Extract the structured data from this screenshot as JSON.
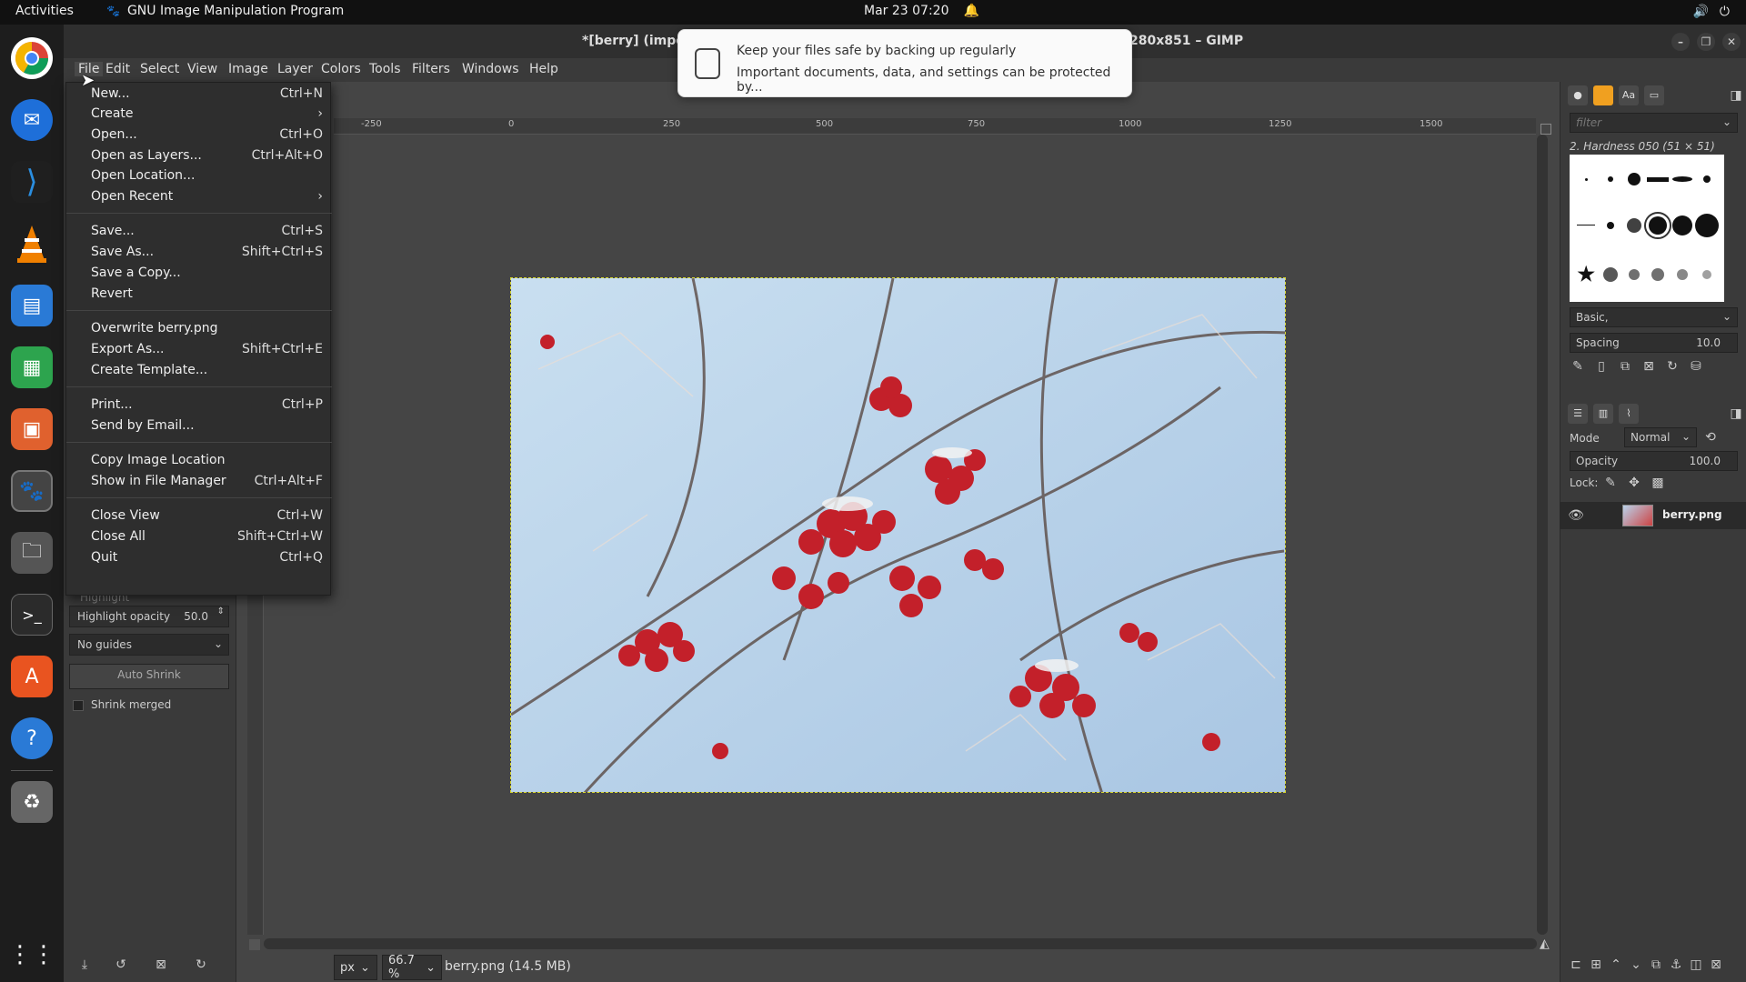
{
  "topbar": {
    "activities": "Activities",
    "app_name": "GNU Image Manipulation Program",
    "clock": "Mar 23  07:20"
  },
  "window": {
    "title_left": "*[berry] (impor",
    "title_right": "280x851 – GIMP"
  },
  "menubar": [
    "File",
    "Edit",
    "Select",
    "View",
    "Image",
    "Layer",
    "Colors",
    "Tools",
    "Filters",
    "Windows",
    "Help"
  ],
  "file_menu": {
    "new": {
      "label": "New...",
      "accel": "Ctrl+N"
    },
    "create": {
      "label": "Create",
      "accel": "›"
    },
    "open": {
      "label": "Open...",
      "accel": "Ctrl+O"
    },
    "open_layers": {
      "label": "Open as Layers...",
      "accel": "Ctrl+Alt+O"
    },
    "open_location": {
      "label": "Open Location...",
      "accel": ""
    },
    "open_recent": {
      "label": "Open Recent",
      "accel": "›"
    },
    "save": {
      "label": "Save...",
      "accel": "Ctrl+S"
    },
    "save_as": {
      "label": "Save As...",
      "accel": "Shift+Ctrl+S"
    },
    "save_copy": {
      "label": "Save a Copy...",
      "accel": ""
    },
    "revert": {
      "label": "Revert",
      "accel": ""
    },
    "overwrite": {
      "label": "Overwrite berry.png",
      "accel": ""
    },
    "export_as": {
      "label": "Export As...",
      "accel": "Shift+Ctrl+E"
    },
    "create_template": {
      "label": "Create Template...",
      "accel": ""
    },
    "print": {
      "label": "Print...",
      "accel": "Ctrl+P"
    },
    "send_email": {
      "label": "Send by Email...",
      "accel": ""
    },
    "copy_location": {
      "label": "Copy Image Location",
      "accel": ""
    },
    "show_fm": {
      "label": "Show in File Manager",
      "accel": "Ctrl+Alt+F"
    },
    "close_view": {
      "label": "Close View",
      "accel": "Ctrl+W"
    },
    "close_all": {
      "label": "Close All",
      "accel": "Shift+Ctrl+W"
    },
    "quit": {
      "label": "Quit",
      "accel": "Ctrl+Q"
    }
  },
  "notification": {
    "title": "Keep your files safe by backing up regularly",
    "body": "Important documents, data, and settings can be protected by..."
  },
  "ruler_ticks": [
    "-250",
    "0",
    "250",
    "500",
    "750",
    "1000",
    "1250",
    "1500"
  ],
  "tool_options": {
    "highlight": "Highlight",
    "highlight_opacity_label": "Highlight opacity",
    "highlight_opacity_value": "50.0",
    "guides": "No guides",
    "auto_shrink": "Auto Shrink",
    "shrink_merged": "Shrink merged"
  },
  "status": {
    "unit": "px",
    "zoom": "66.7 %",
    "file_info": "berry.png (14.5 MB)"
  },
  "brushes": {
    "filter_placeholder": "filter",
    "brush_name": "2. Hardness 050 (51 × 51)",
    "preset": "Basic,",
    "spacing_label": "Spacing",
    "spacing_value": "10.0"
  },
  "layers": {
    "mode_label": "Mode",
    "mode_value": "Normal",
    "opacity_label": "Opacity",
    "opacity_value": "100.0",
    "lock_label": "Lock:",
    "layer_name": "berry.png"
  }
}
